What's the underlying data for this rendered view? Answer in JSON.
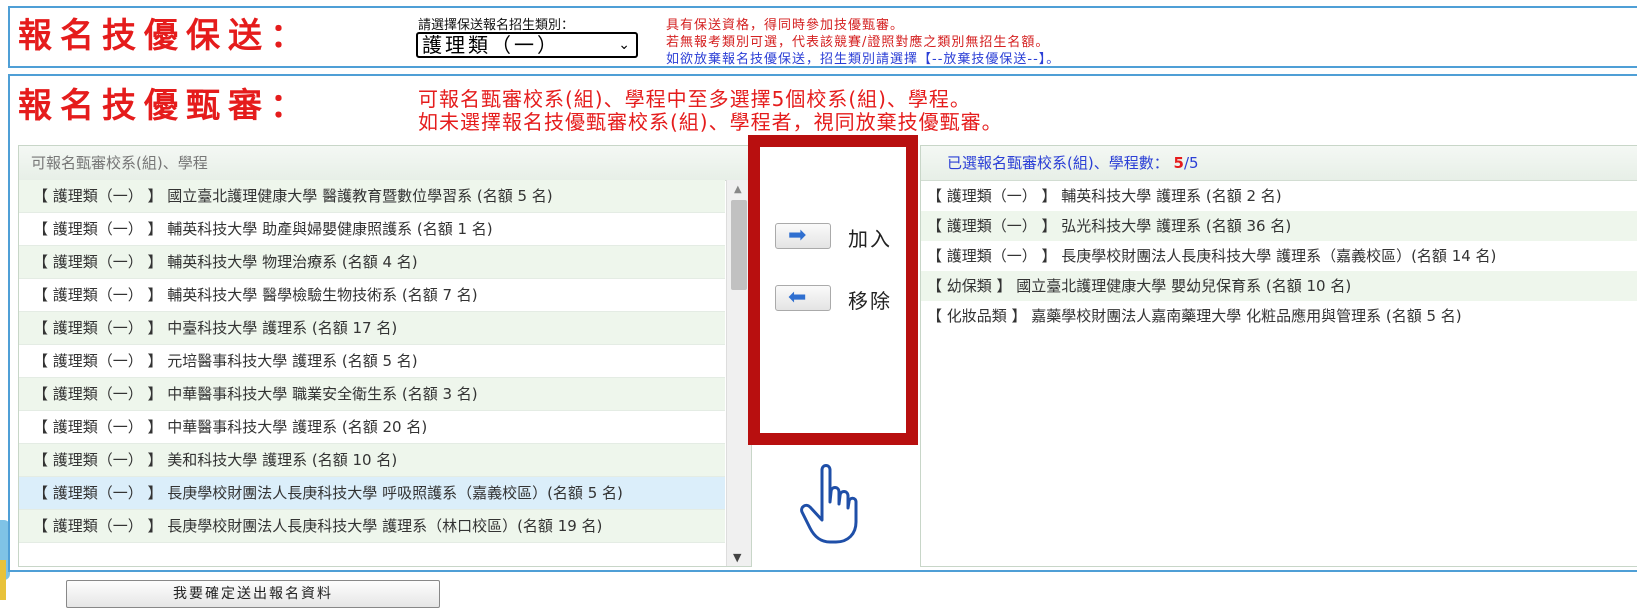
{
  "section_proxy": {
    "title": "報名技優保送：",
    "category_label": "請選擇保送報名招生類別：",
    "category_value": "護理類（一）",
    "notes": [
      "具有保送資格，得同時參加技優甄審。",
      "若無報考類別可選，代表該競賽/證照對應之類別無招生名額。",
      "如欲放棄報名技優保送，招生類別請選擇【--放棄技優保送--】。"
    ]
  },
  "section_review": {
    "title": "報名技優甄審：",
    "instructions": [
      "可報名甄審校系(組)、學程中至多選擇5個校系(組)、學程。",
      "如未選擇報名技優甄審校系(組)、學程者，視同放棄技優甄審。"
    ]
  },
  "available": {
    "header": "可報名甄審校系(組)、學程",
    "items": [
      "【 護理類（一） 】 國立臺北護理健康大學 醫護教育暨數位學習系 (名額 5 名)",
      "【 護理類（一） 】 輔英科技大學 助產與婦嬰健康照護系 (名額 1 名)",
      "【 護理類（一） 】 輔英科技大學 物理治療系 (名額 4 名)",
      "【 護理類（一） 】 輔英科技大學 醫學檢驗生物技術系 (名額 7 名)",
      "【 護理類（一） 】 中臺科技大學 護理系 (名額 17 名)",
      "【 護理類（一） 】 元培醫事科技大學 護理系 (名額 5 名)",
      "【 護理類（一） 】 中華醫事科技大學 職業安全衛生系 (名額 3 名)",
      "【 護理類（一） 】 中華醫事科技大學 護理系 (名額 20 名)",
      "【 護理類（一） 】 美和科技大學 護理系 (名額 10 名)",
      "【 護理類（一） 】 長庚學校財團法人長庚科技大學 呼吸照護系（嘉義校區）(名額 5 名)",
      "【 護理類（一） 】 長庚學校財團法人長庚科技大學 護理系（林口校區）(名額 19 名)"
    ]
  },
  "buttons": {
    "add": "加入",
    "remove": "移除",
    "submit": "我要確定送出報名資料"
  },
  "selected": {
    "header": "已選報名甄審校系(組)、學程數：",
    "count": "5",
    "max": "/5",
    "items": [
      "【 護理類（一） 】 輔英科技大學 護理系 (名額 2 名)",
      "【 護理類（一） 】 弘光科技大學 護理系 (名額 36 名)",
      "【 護理類（一） 】 長庚學校財團法人長庚科技大學 護理系（嘉義校區）(名額 14 名)",
      "【 幼保類 】 國立臺北護理健康大學 嬰幼兒保育系 (名額 10 名)",
      "【 化妝品類 】 嘉藥學校財團法人嘉南藥理大學 化粧品應用與管理系 (名額 5 名)"
    ]
  },
  "icons": {
    "add_arrow": "arrow-right-icon",
    "remove_arrow": "arrow-left-icon",
    "pointer": "hand-pointer-icon",
    "chevron": "chevron-down-icon"
  },
  "colors": {
    "title_red": "#e51c1c",
    "note_blue": "#2b3fd6",
    "highlight_box": "#b80f0f",
    "frame_blue": "#4f9fd6"
  }
}
